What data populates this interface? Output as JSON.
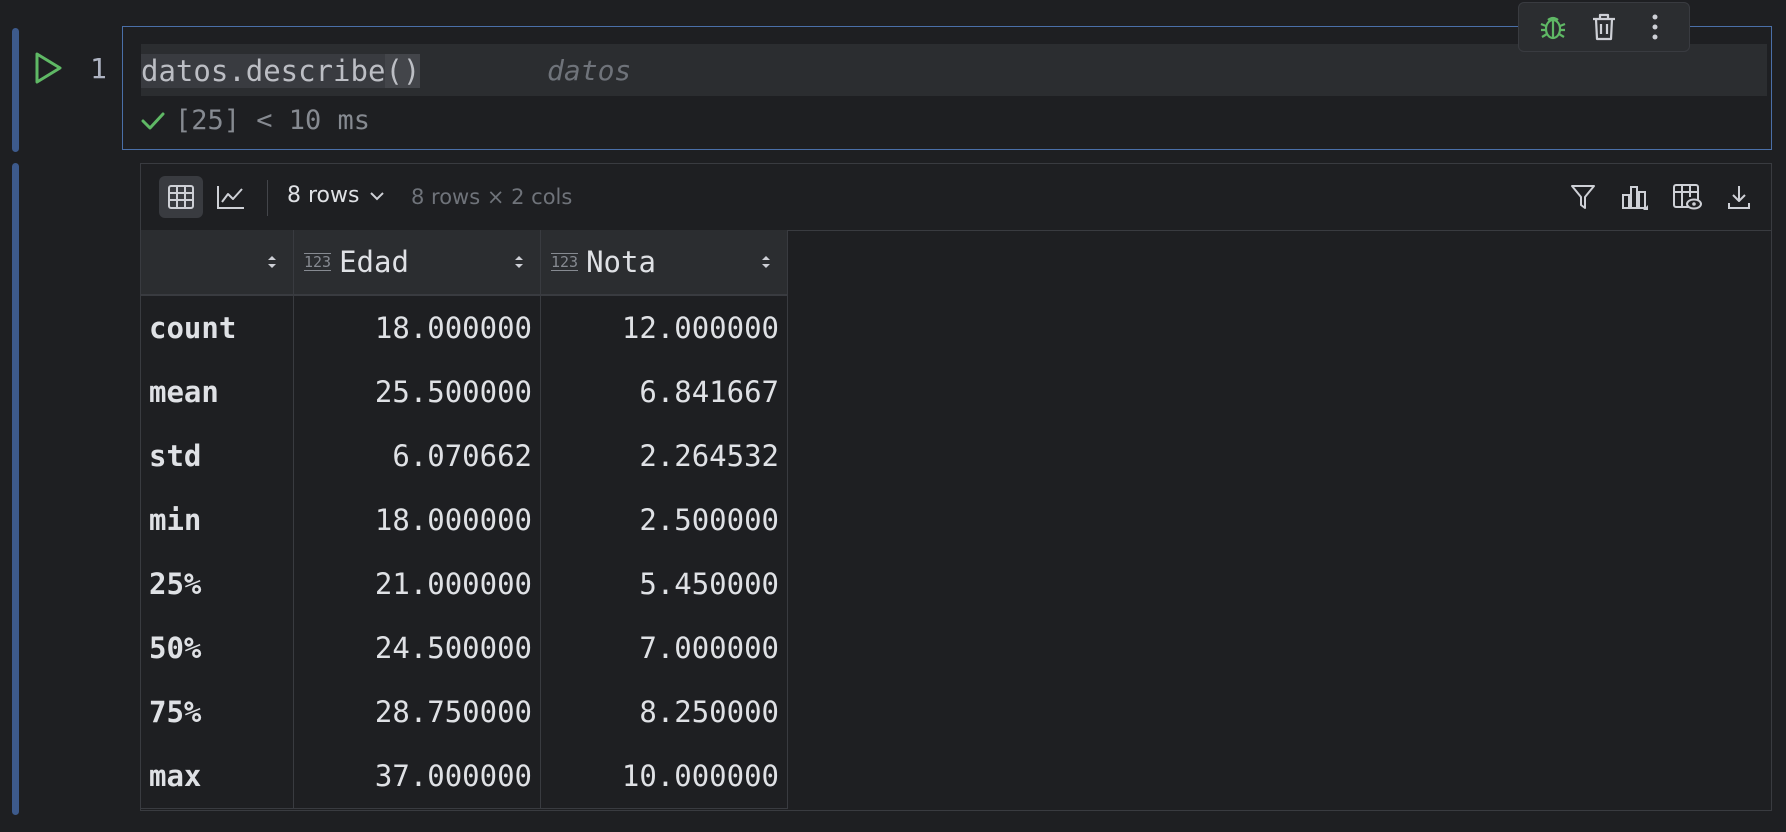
{
  "cell": {
    "line_number": "1",
    "code": "datos.describe",
    "code_parens": "()",
    "inline_hint": "datos",
    "exec_status": "[25] < 10 ms"
  },
  "toolbar": {
    "icons": [
      "debug-icon",
      "trash-icon",
      "more-vert-icon"
    ]
  },
  "output": {
    "rows_select_label": "8 rows",
    "shape_text": "8 rows × 2 cols",
    "right_icons": [
      "filter-icon",
      "chart-settings-icon",
      "column-visibility-icon",
      "download-icon"
    ],
    "columns": [
      {
        "name": "",
        "type": ""
      },
      {
        "name": "Edad",
        "type": "123"
      },
      {
        "name": "Nota",
        "type": "123"
      }
    ],
    "rows": [
      {
        "index": "count",
        "edad": "18.000000",
        "nota": "12.000000"
      },
      {
        "index": "mean",
        "edad": "25.500000",
        "nota": "6.841667"
      },
      {
        "index": "std",
        "edad": "6.070662",
        "nota": "2.264532"
      },
      {
        "index": "min",
        "edad": "18.000000",
        "nota": "2.500000"
      },
      {
        "index": "25%",
        "edad": "21.000000",
        "nota": "5.450000"
      },
      {
        "index": "50%",
        "edad": "24.500000",
        "nota": "7.000000"
      },
      {
        "index": "75%",
        "edad": "28.750000",
        "nota": "8.250000"
      },
      {
        "index": "max",
        "edad": "37.000000",
        "nota": "10.000000"
      }
    ]
  },
  "colors": {
    "accent_green": "#5fb865",
    "cell_border": "#4a6fa8",
    "gutter": "#3d5a8c"
  }
}
